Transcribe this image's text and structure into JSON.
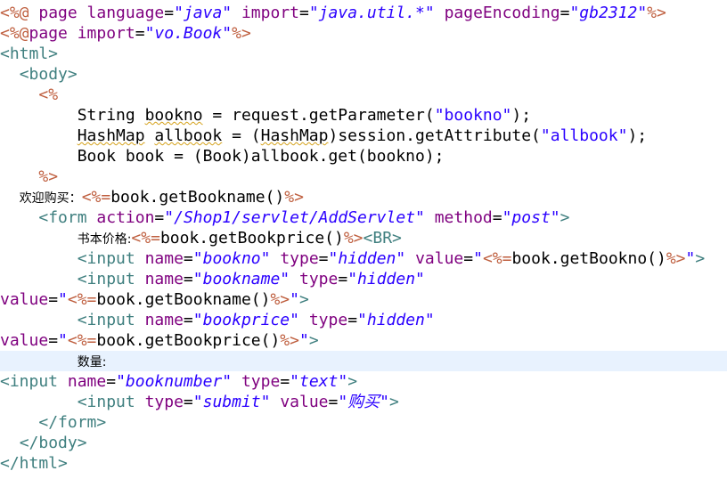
{
  "editor": {
    "current_line": 17,
    "lines": [
      {
        "tokens": [
          {
            "t": "<%@ ",
            "c": "directive"
          },
          {
            "t": "page ",
            "c": "attr"
          },
          {
            "t": "language",
            "c": "attr"
          },
          {
            "t": "=",
            "c": "eq"
          },
          {
            "t": "\"java\"",
            "c": "val"
          },
          {
            "t": " ",
            "c": "plain"
          },
          {
            "t": "import",
            "c": "attr"
          },
          {
            "t": "=",
            "c": "eq"
          },
          {
            "t": "\"java.util.*\"",
            "c": "val"
          },
          {
            "t": " ",
            "c": "plain"
          },
          {
            "t": "pageEncoding",
            "c": "attr"
          },
          {
            "t": "=",
            "c": "eq"
          },
          {
            "t": "\"gb2312\"",
            "c": "val"
          },
          {
            "t": "%>",
            "c": "directive"
          }
        ]
      },
      {
        "tokens": [
          {
            "t": "<%@",
            "c": "directive"
          },
          {
            "t": "page ",
            "c": "attr"
          },
          {
            "t": "import",
            "c": "attr"
          },
          {
            "t": "=",
            "c": "eq"
          },
          {
            "t": "\"vo.Book\"",
            "c": "val"
          },
          {
            "t": "%>",
            "c": "directive"
          }
        ]
      },
      {
        "tokens": [
          {
            "t": "<html>",
            "c": "kw"
          }
        ]
      },
      {
        "tokens": [
          {
            "t": "  ",
            "c": "plain"
          },
          {
            "t": "<body>",
            "c": "kw"
          }
        ]
      },
      {
        "tokens": [
          {
            "t": "    ",
            "c": "plain"
          },
          {
            "t": "<%",
            "c": "directive"
          }
        ]
      },
      {
        "tokens": [
          {
            "t": "        String ",
            "c": "plain"
          },
          {
            "t": "bookno",
            "c": "plain",
            "squiggle": true
          },
          {
            "t": " = request.getParameter(",
            "c": "plain"
          },
          {
            "t": "\"bookno\"",
            "c": "str"
          },
          {
            "t": ");",
            "c": "plain"
          }
        ]
      },
      {
        "tokens": [
          {
            "t": "        ",
            "c": "plain"
          },
          {
            "t": "HashMap",
            "c": "plain",
            "squiggle": true
          },
          {
            "t": " ",
            "c": "plain"
          },
          {
            "t": "allbook",
            "c": "plain",
            "squiggle": true
          },
          {
            "t": " = (",
            "c": "plain"
          },
          {
            "t": "HashMap",
            "c": "plain",
            "squiggle": true
          },
          {
            "t": ")session.getAttribute(",
            "c": "plain"
          },
          {
            "t": "\"allbook\"",
            "c": "str"
          },
          {
            "t": ");",
            "c": "plain"
          }
        ]
      },
      {
        "tokens": [
          {
            "t": "        Book book = (Book)allbook.get(bookno);",
            "c": "plain"
          }
        ]
      },
      {
        "tokens": [
          {
            "t": "    ",
            "c": "plain"
          },
          {
            "t": "%>",
            "c": "directive"
          }
        ]
      },
      {
        "tokens": [
          {
            "t": "  ",
            "c": "plain"
          },
          {
            "t": "欢迎购买：",
            "c": "cjk"
          },
          {
            "t": "<%=",
            "c": "directive"
          },
          {
            "t": "book.getBookname()",
            "c": "plain"
          },
          {
            "t": "%>",
            "c": "directive"
          }
        ]
      },
      {
        "tokens": [
          {
            "t": "    ",
            "c": "plain"
          },
          {
            "t": "<form ",
            "c": "kw"
          },
          {
            "t": "action",
            "c": "attr"
          },
          {
            "t": "=",
            "c": "eq"
          },
          {
            "t": "\"/Shop1/servlet/AddServlet\"",
            "c": "val"
          },
          {
            "t": " ",
            "c": "plain"
          },
          {
            "t": "method",
            "c": "attr"
          },
          {
            "t": "=",
            "c": "eq"
          },
          {
            "t": "\"post\"",
            "c": "val"
          },
          {
            "t": ">",
            "c": "kw"
          }
        ]
      },
      {
        "tokens": [
          {
            "t": "        ",
            "c": "plain"
          },
          {
            "t": "书本价格:",
            "c": "cjk"
          },
          {
            "t": "<%=",
            "c": "directive"
          },
          {
            "t": "book.getBookprice()",
            "c": "plain"
          },
          {
            "t": "%>",
            "c": "directive"
          },
          {
            "t": "<BR>",
            "c": "kw"
          }
        ]
      },
      {
        "tokens": [
          {
            "t": "        ",
            "c": "plain"
          },
          {
            "t": "<input ",
            "c": "kw"
          },
          {
            "t": "name",
            "c": "attr"
          },
          {
            "t": "=",
            "c": "eq"
          },
          {
            "t": "\"bookno\"",
            "c": "val"
          },
          {
            "t": " ",
            "c": "plain"
          },
          {
            "t": "type",
            "c": "attr"
          },
          {
            "t": "=",
            "c": "eq"
          },
          {
            "t": "\"hidden\"",
            "c": "val"
          },
          {
            "t": " ",
            "c": "plain"
          },
          {
            "t": "value",
            "c": "attr"
          },
          {
            "t": "=",
            "c": "eq"
          },
          {
            "t": "\"",
            "c": "str"
          },
          {
            "t": "<%=",
            "c": "directive"
          },
          {
            "t": "book.getBookno()",
            "c": "plain"
          },
          {
            "t": "%>",
            "c": "directive"
          },
          {
            "t": "\"",
            "c": "str"
          },
          {
            "t": ">",
            "c": "kw"
          }
        ]
      },
      {
        "tokens": [
          {
            "t": "        ",
            "c": "plain"
          },
          {
            "t": "<input ",
            "c": "kw"
          },
          {
            "t": "name",
            "c": "attr"
          },
          {
            "t": "=",
            "c": "eq"
          },
          {
            "t": "\"bookname\"",
            "c": "val"
          },
          {
            "t": " ",
            "c": "plain"
          },
          {
            "t": "type",
            "c": "attr"
          },
          {
            "t": "=",
            "c": "eq"
          },
          {
            "t": "\"hidden\"",
            "c": "val"
          }
        ]
      },
      {
        "tokens": [
          {
            "t": "value",
            "c": "attr"
          },
          {
            "t": "=",
            "c": "eq"
          },
          {
            "t": "\"",
            "c": "str"
          },
          {
            "t": "<%=",
            "c": "directive"
          },
          {
            "t": "book.getBookname()",
            "c": "plain"
          },
          {
            "t": "%>",
            "c": "directive"
          },
          {
            "t": "\"",
            "c": "str"
          },
          {
            "t": ">",
            "c": "kw"
          }
        ]
      },
      {
        "tokens": [
          {
            "t": "        ",
            "c": "plain"
          },
          {
            "t": "<input ",
            "c": "kw"
          },
          {
            "t": "name",
            "c": "attr"
          },
          {
            "t": "=",
            "c": "eq"
          },
          {
            "t": "\"bookprice\"",
            "c": "val"
          },
          {
            "t": " ",
            "c": "plain"
          },
          {
            "t": "type",
            "c": "attr"
          },
          {
            "t": "=",
            "c": "eq"
          },
          {
            "t": "\"hidden\"",
            "c": "val"
          }
        ]
      },
      {
        "tokens": [
          {
            "t": "value",
            "c": "attr"
          },
          {
            "t": "=",
            "c": "eq"
          },
          {
            "t": "\"",
            "c": "str"
          },
          {
            "t": "<%=",
            "c": "directive"
          },
          {
            "t": "book.getBookprice()",
            "c": "plain"
          },
          {
            "t": "%>",
            "c": "directive"
          },
          {
            "t": "\"",
            "c": "str"
          },
          {
            "t": ">",
            "c": "kw"
          }
        ]
      },
      {
        "tokens": [
          {
            "t": "        ",
            "c": "plain"
          },
          {
            "t": "数量:",
            "c": "cjk"
          }
        ]
      },
      {
        "tokens": [
          {
            "t": "<input ",
            "c": "kw"
          },
          {
            "t": "name",
            "c": "attr"
          },
          {
            "t": "=",
            "c": "eq"
          },
          {
            "t": "\"booknumber\"",
            "c": "val"
          },
          {
            "t": " ",
            "c": "plain"
          },
          {
            "t": "type",
            "c": "attr"
          },
          {
            "t": "=",
            "c": "eq"
          },
          {
            "t": "\"text\"",
            "c": "val"
          },
          {
            "t": ">",
            "c": "kw"
          }
        ]
      },
      {
        "tokens": [
          {
            "t": "        ",
            "c": "plain"
          },
          {
            "t": "<input ",
            "c": "kw"
          },
          {
            "t": "type",
            "c": "attr"
          },
          {
            "t": "=",
            "c": "eq"
          },
          {
            "t": "\"submit\"",
            "c": "val"
          },
          {
            "t": " ",
            "c": "plain"
          },
          {
            "t": "value",
            "c": "attr"
          },
          {
            "t": "=",
            "c": "eq"
          },
          {
            "t": "\"购买\"",
            "c": "val"
          },
          {
            "t": ">",
            "c": "kw"
          }
        ]
      },
      {
        "tokens": [
          {
            "t": "    ",
            "c": "plain"
          },
          {
            "t": "</form>",
            "c": "kw"
          }
        ]
      },
      {
        "tokens": [
          {
            "t": "  ",
            "c": "plain"
          },
          {
            "t": "</body>",
            "c": "kw"
          }
        ]
      },
      {
        "tokens": [
          {
            "t": "</html>",
            "c": "kw"
          }
        ]
      }
    ]
  }
}
